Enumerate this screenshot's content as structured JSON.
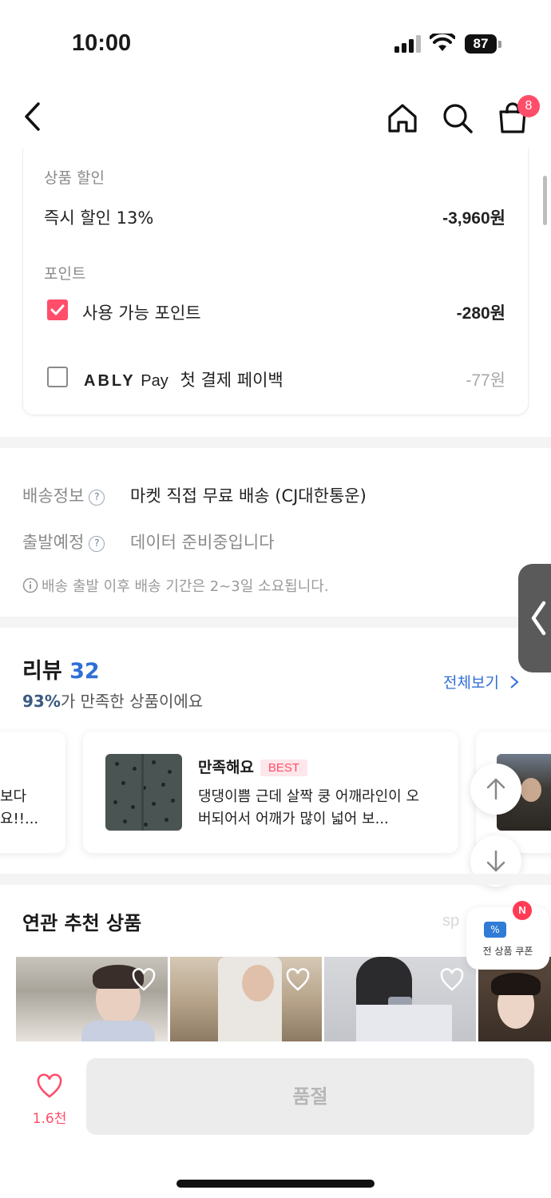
{
  "status_bar": {
    "time": "10:00",
    "battery": "87"
  },
  "nav": {
    "cart_count": "8"
  },
  "discount": {
    "product_discount_label": "상품 할인",
    "instant_discount_label": "즉시 할인 13%",
    "instant_discount_amount": "-3,960원",
    "point_label": "포인트",
    "available_point_label": "사용 가능 포인트",
    "available_point_amount": "-280원",
    "ably_brand": "ABLY",
    "pay_word": "Pay",
    "payback_label": "첫 결제 페이백",
    "payback_amount": "-77원"
  },
  "shipping": {
    "info_label": "배송정보",
    "info_value": "마켓 직접 무료 배송 (CJ대한통운)",
    "departure_label": "출발예정",
    "departure_value": "데이터 준비중입니다",
    "note": "배송 출발 이후 배송 기간은 2~3일 소요됩니다."
  },
  "review": {
    "title": "리뷰",
    "count": "32",
    "satisfaction_pct": "93%",
    "satisfaction_text": "가 만족한 상품이에요",
    "see_all": "전체보기",
    "prev_card_line1": "보다",
    "prev_card_line2": "요!!...",
    "card_rating_label": "만족해요",
    "card_badge": "BEST",
    "card_text": "댕댕이쁨 근데 살짝 쿵 어깨라인이 오버되어서 어깨가 많이 넓어 보..."
  },
  "related": {
    "title": "연관 추천 상품",
    "sponsored_partial": "sp",
    "coupon_label": "전 상품 쿠폰",
    "coupon_badge": "N"
  },
  "bottom_bar": {
    "like_count": "1.6천",
    "action_label": "품절"
  },
  "colors": {
    "accent_pink": "#ff4d6a",
    "link_blue": "#2f6fd6",
    "coupon_blue": "#2f7bd6"
  }
}
